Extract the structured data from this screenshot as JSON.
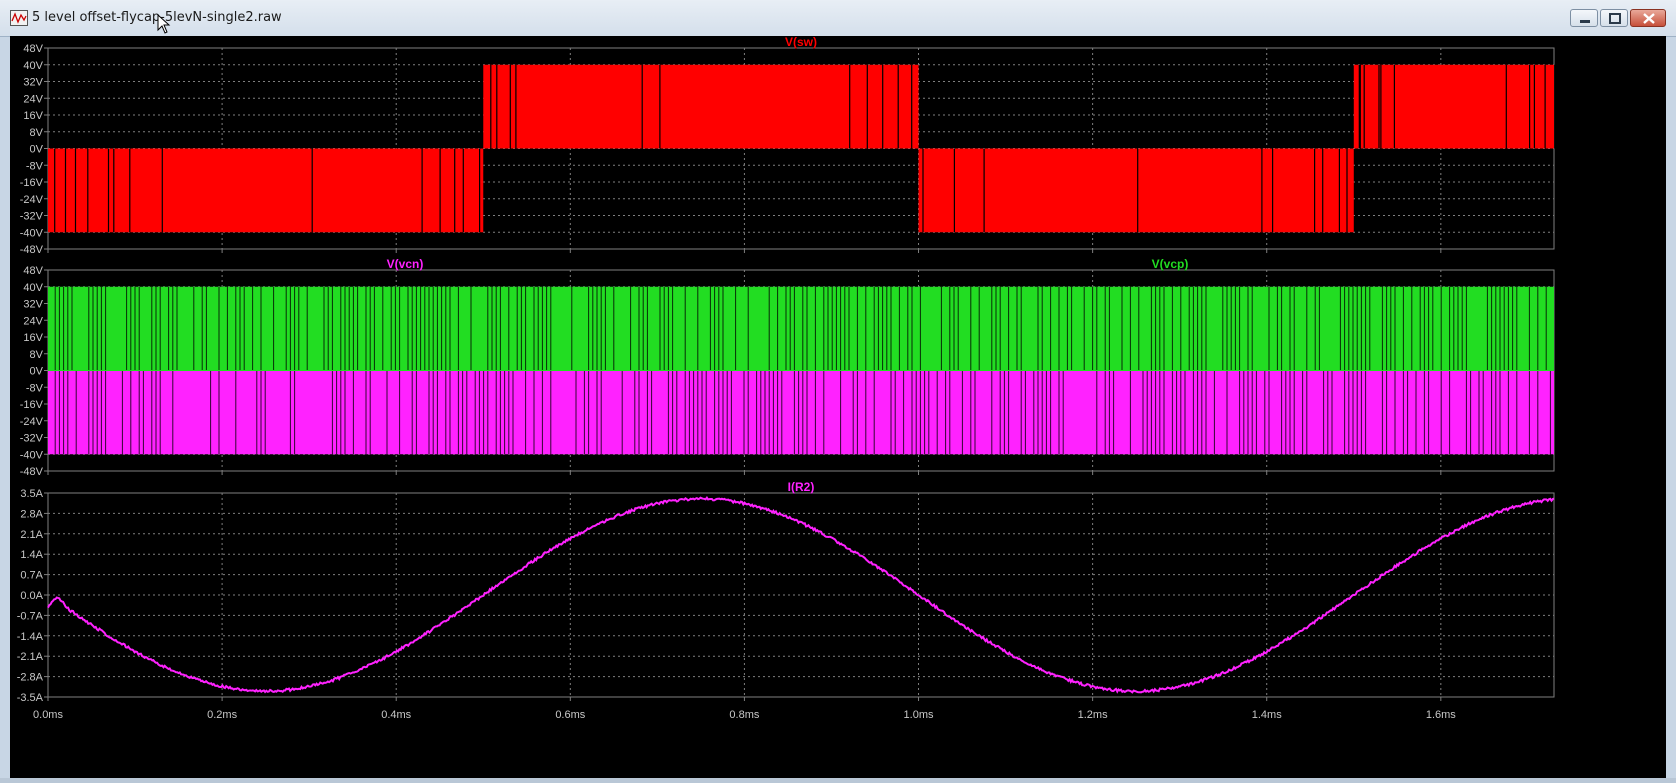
{
  "window": {
    "title": "5 level offset-flycap-5levN-single2.raw",
    "icon": "waveform-viewer-icon"
  },
  "colors": {
    "plot_bg": "#000000",
    "grid": "#7f7f7f",
    "axis_text": "#c8c8c8",
    "red_trace": "#ff0000",
    "green_trace": "#22dd22",
    "magenta_trace": "#ff22ff"
  },
  "x_ticks": [
    "0.0ms",
    "0.2ms",
    "0.4ms",
    "0.6ms",
    "0.8ms",
    "1.0ms",
    "1.2ms",
    "1.4ms",
    "1.6ms"
  ],
  "chart_data": [
    {
      "type": "line",
      "name": "pane-1",
      "traces": [
        {
          "name": "V(sw)",
          "color": "#ff0000"
        }
      ],
      "y_ticks": [
        "48V",
        "40V",
        "32V",
        "24V",
        "16V",
        "8V",
        "0V",
        "-8V",
        "-16V",
        "-24V",
        "-32V",
        "-40V",
        "-48V"
      ],
      "ylim": [
        -48,
        48
      ],
      "xlim_ms": [
        0,
        1.73
      ],
      "series": [
        {
          "name": "V(sw)",
          "description_segments": [
            {
              "x_ms": [
                0.0,
                0.5
              ],
              "low": -40,
              "high": 0
            },
            {
              "x_ms": [
                0.5,
                1.0
              ],
              "low": 0,
              "high": 40
            },
            {
              "x_ms": [
                1.0,
                1.5
              ],
              "low": -40,
              "high": 0
            },
            {
              "x_ms": [
                1.5,
                1.73
              ],
              "low": 0,
              "high": 40
            }
          ]
        }
      ]
    },
    {
      "type": "line",
      "name": "pane-2",
      "traces": [
        {
          "name": "V(vcn)",
          "color": "#ff22ff"
        },
        {
          "name": "V(vcp)",
          "color": "#22dd22"
        }
      ],
      "y_ticks": [
        "48V",
        "40V",
        "32V",
        "24V",
        "16V",
        "8V",
        "0V",
        "-8V",
        "-16V",
        "-24V",
        "-32V",
        "-40V",
        "-48V"
      ],
      "ylim": [
        -48,
        48
      ],
      "xlim_ms": [
        0,
        1.73
      ],
      "series": [
        {
          "name": "V(vcp)",
          "low": 0,
          "high": 40
        },
        {
          "name": "V(vcn)",
          "low": -40,
          "high": 0
        }
      ]
    },
    {
      "type": "line",
      "name": "pane-3",
      "traces": [
        {
          "name": "I(R2)",
          "color": "#ff22ff"
        }
      ],
      "y_ticks": [
        "3.5A",
        "2.8A",
        "2.1A",
        "1.4A",
        "0.7A",
        "0.0A",
        "-0.7A",
        "-1.4A",
        "-2.1A",
        "-2.8A",
        "-3.5A"
      ],
      "ylim": [
        -3.5,
        3.5
      ],
      "xlim_ms": [
        0,
        1.73
      ],
      "series": [
        {
          "name": "I(R2)",
          "x_ms": [
            0.0,
            0.01,
            0.25,
            0.5,
            0.75,
            1.0,
            1.25,
            1.5,
            1.73
          ],
          "y": [
            0.0,
            0.0,
            -3.3,
            0.0,
            3.3,
            0.0,
            -3.3,
            0.0,
            3.3
          ]
        }
      ]
    }
  ]
}
